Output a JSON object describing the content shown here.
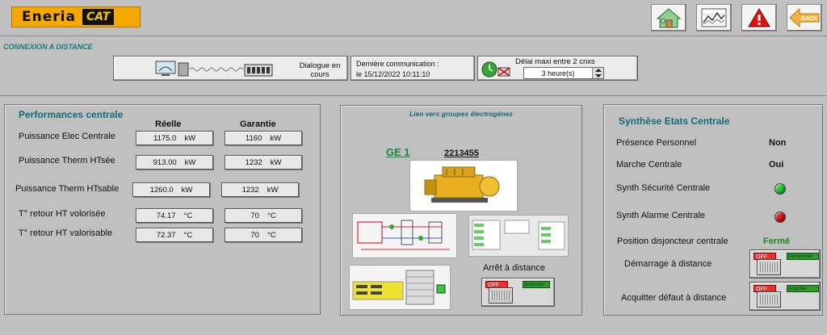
{
  "header": {
    "brand": "Eneria",
    "brand_mark": "CAT",
    "buttons": [
      {
        "name": "home-icon",
        "label": ""
      },
      {
        "name": "trend-chart-icon",
        "label": ""
      },
      {
        "name": "alarm-warning-icon",
        "label": ""
      },
      {
        "name": "back-arrow-icon",
        "label": "BACK"
      }
    ]
  },
  "connection": {
    "section_title": "CONNEXION A DISTANCE",
    "dialog_status": "Dialogue en cours",
    "last_comm_label": "Dernière communication :",
    "last_comm_value": "le  15/12/2022 10:11:10",
    "max_delay_label": "Délai maxi entre 2 cnxs",
    "max_delay_value": "3 heure(s)"
  },
  "performance": {
    "title": "Performances centrale",
    "col_real": "Réelle",
    "col_guaranteed": "Garantie",
    "rows": [
      {
        "label": "Puissance Elec Centrale",
        "real": "1175.0",
        "real_unit": "kW",
        "guaranteed": "1160",
        "guaranteed_unit": "kW"
      },
      {
        "label": "Puissance Therm HTsée",
        "real": "913.00",
        "real_unit": "kW",
        "guaranteed": "1232",
        "guaranteed_unit": "kW"
      },
      {
        "label": "Puissance Therm HTsable",
        "real": "1260.0",
        "real_unit": "kW",
        "guaranteed": "1232",
        "guaranteed_unit": "kW"
      },
      {
        "label": "T° retour HT volorisée",
        "real": "74.17",
        "real_unit": "°C",
        "guaranteed": "70",
        "guaranteed_unit": "°C"
      },
      {
        "label": "T° retour HT valorisable",
        "real": "72.37",
        "real_unit": "°C",
        "guaranteed": "70",
        "guaranteed_unit": "°C"
      }
    ]
  },
  "gensets": {
    "title": "Lien vers groupes électrogènes",
    "unit_link": "GE 1",
    "unit_serial": "2213455",
    "remote_stop_label": "Arrêt à distance",
    "switch_off": "OFF",
    "switch_on": "Autorisée"
  },
  "status": {
    "title": "Synthèse Etats Centrale",
    "staff_presence_label": "Présence Personnel",
    "staff_presence_value": "Non",
    "plant_running_label": "Marche Centrale",
    "plant_running_value": "Oui",
    "safety_label": "Synth Sécurité Centrale",
    "alarm_label": "Synth Alarme Centrale",
    "breaker_label": "Position disjoncteur centrale",
    "breaker_value": "Fermé",
    "remote_start_label": "Démarrage  à distance",
    "ack_fault_label": "Acquitter défaut à distance",
    "switch_off": "OFF",
    "switch_on": "Déclencher",
    "switch_on_ack": "Acquitter",
    "colors": {
      "safety_led": "#2ecc40",
      "alarm_led": "#e02020",
      "ok_text": "#1a8a1a"
    }
  }
}
